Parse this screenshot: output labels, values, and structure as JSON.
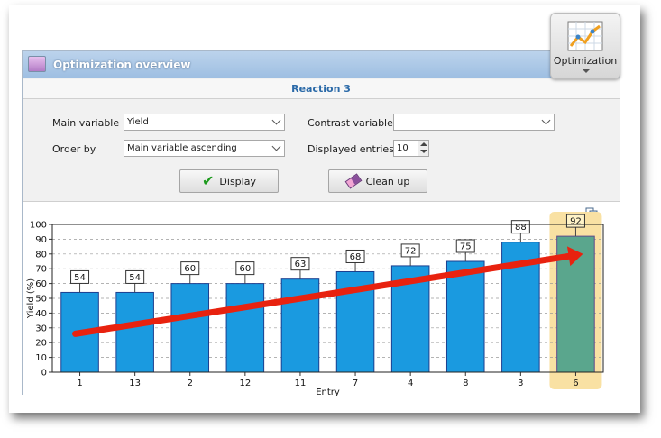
{
  "window": {
    "title": "Optimization overview"
  },
  "ribbon": {
    "label": "Optimization"
  },
  "section": {
    "title": "Reaction 3"
  },
  "form": {
    "main_variable_label": "Main variable",
    "main_variable_value": "Yield",
    "contrast_variable_label": "Contrast variable",
    "contrast_variable_value": "",
    "order_by_label": "Order by",
    "order_by_value": "Main variable ascending",
    "displayed_entries_label": "Displayed entries",
    "displayed_entries_value": "10"
  },
  "buttons": {
    "display": "Display",
    "cleanup": "Clean up"
  },
  "colors": {
    "bar": "#1a9ae0",
    "highlight_bar": "#5aa68d",
    "highlight_box": "#f9e1a3",
    "arrow": "#e8220f"
  },
  "chart_data": {
    "type": "bar",
    "categories": [
      "1",
      "13",
      "2",
      "12",
      "11",
      "7",
      "4",
      "8",
      "3",
      "6"
    ],
    "values": [
      54,
      54,
      60,
      60,
      63,
      68,
      72,
      75,
      88,
      92
    ],
    "data_labels": [
      "54",
      "54",
      "60",
      "60",
      "63",
      "68",
      "72",
      "75",
      "88",
      "92"
    ],
    "highlighted_category": "6",
    "xlabel": "Entry",
    "ylabel": "Yield (%)",
    "ylim": [
      0,
      100
    ],
    "yticks": [
      "0",
      "10",
      "20",
      "30",
      "40",
      "50",
      "60",
      "70",
      "80",
      "90",
      "100"
    ],
    "grid": true,
    "trend_arrow": true
  }
}
